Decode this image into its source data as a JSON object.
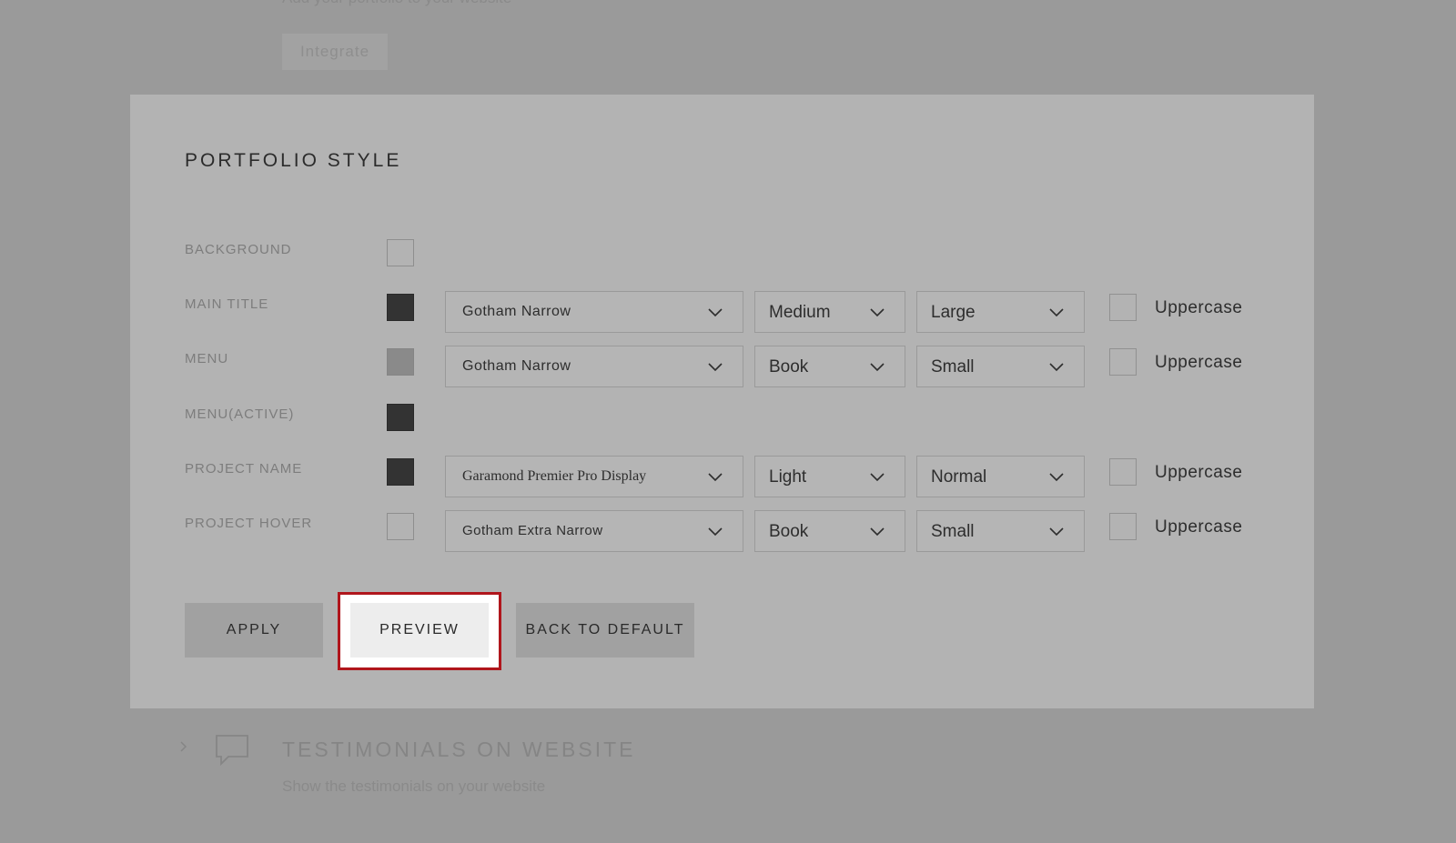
{
  "background_page": {
    "top_subtitle": "Add your portfolio to your website",
    "integrate_button": "Integrate",
    "section_title": "TESTIMONIALS ON WEBSITE",
    "section_subtitle": "Show the testimonials on your website",
    "section_icon": "chat-bubble-icon",
    "expand_icon": "chevron-right-icon"
  },
  "modal": {
    "title": "PORTFOLIO STYLE",
    "rows": [
      {
        "label": "BACKGROUND",
        "swatch_color": "#ffffff00"
      },
      {
        "label": "MAIN TITLE",
        "swatch_color": "#333333",
        "font": "Gotham Narrow",
        "weight": "Medium",
        "size": "Large",
        "uppercase_label": "Uppercase",
        "uppercase_checked": false
      },
      {
        "label": "MENU",
        "swatch_color": "#8a8a8a",
        "font": "Gotham Narrow",
        "weight": "Book",
        "size": "Small",
        "uppercase_label": "Uppercase",
        "uppercase_checked": false
      },
      {
        "label": "MENU(ACTIVE)",
        "swatch_color": "#333333"
      },
      {
        "label": "PROJECT NAME",
        "swatch_color": "#333333",
        "font": "Garamond Premier Pro Display",
        "weight": "Light",
        "size": "Normal",
        "uppercase_label": "Uppercase",
        "uppercase_checked": false
      },
      {
        "label": "PROJECT HOVER",
        "swatch_color": "#ffffff00",
        "font": "Gotham Extra Narrow",
        "weight": "Book",
        "size": "Small",
        "uppercase_label": "Uppercase",
        "uppercase_checked": false
      }
    ],
    "buttons": {
      "apply": "APPLY",
      "preview": "PREVIEW",
      "back_to_default": "BACK TO DEFAULT"
    },
    "highlight_color": "#b0161c"
  }
}
